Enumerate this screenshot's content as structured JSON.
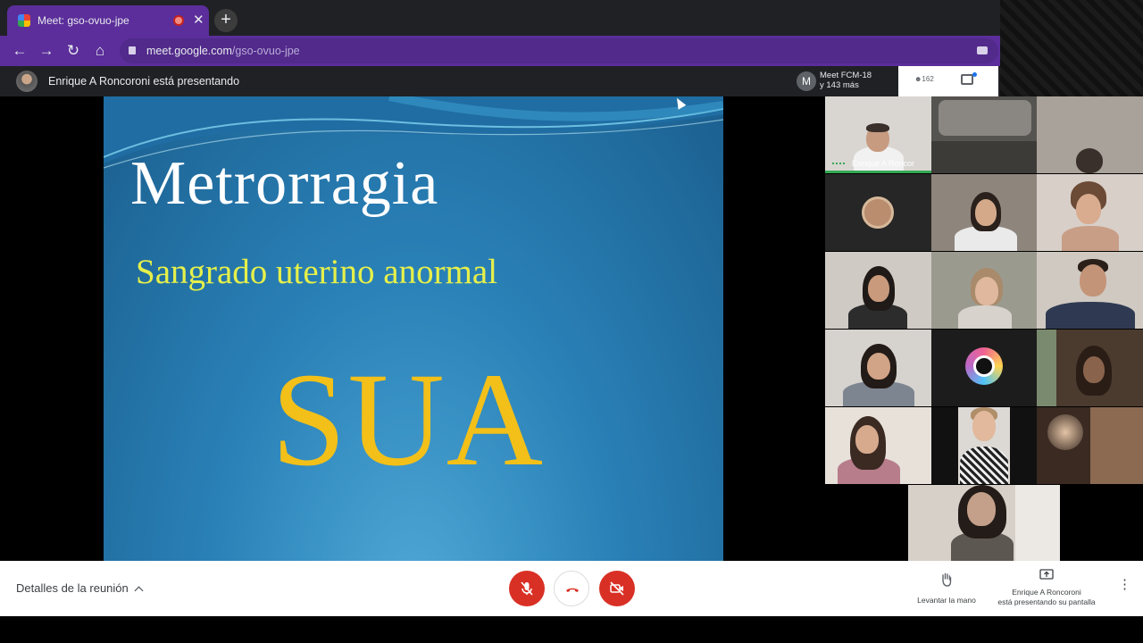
{
  "browser": {
    "tab_title": "Meet: gso-ovuo-jpe",
    "new_tab_label": "+",
    "close_label": "✕",
    "url_host": "meet.google.com",
    "url_path": "/gso-ovuo-jpe"
  },
  "meet": {
    "presenter_banner": "Enrique A Roncoroni está presentando",
    "meeting_badge_initial": "M",
    "meeting_name": "Meet FCM-18",
    "meeting_more": "y 143 más",
    "people_count": "162",
    "slide": {
      "title": "Metrorragia",
      "subtitle": "Sangrado uterino anormal",
      "acronym": "SUA"
    },
    "self_tile_name": "Enrique A Roncor",
    "controls": {
      "details_label": "Detalles de la reunión",
      "raise_hand_label": "Levantar la mano",
      "presenting_line1": "Enrique A Roncoroni",
      "presenting_line2": "está presentando su pantalla"
    }
  },
  "colors": {
    "browser_accent": "#5b2e9b",
    "mute_red": "#d93025",
    "slide_title": "#ffffff",
    "slide_subtitle": "#e6f04a",
    "slide_acronym": "#f2c019"
  },
  "icons": [
    "back-icon",
    "forward-icon",
    "reload-icon",
    "home-icon",
    "lock-icon",
    "camera-icon",
    "people-icon",
    "chat-icon",
    "mic-off-icon",
    "hangup-icon",
    "camera-off-icon",
    "raise-hand-icon",
    "present-icon",
    "more-icon"
  ]
}
